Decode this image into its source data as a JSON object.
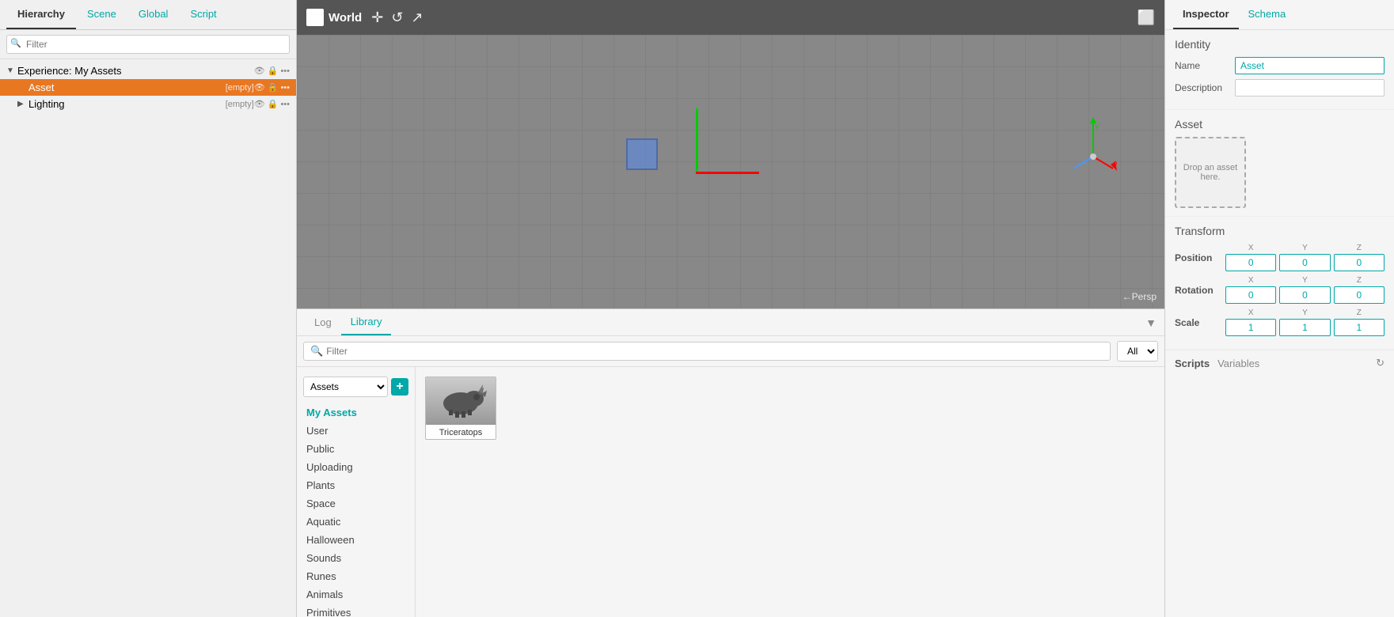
{
  "left_panel": {
    "tabs": [
      {
        "id": "hierarchy",
        "label": "Hierarchy",
        "active": true
      },
      {
        "id": "scene",
        "label": "Scene",
        "active": false
      },
      {
        "id": "global",
        "label": "Global",
        "active": false
      },
      {
        "id": "script",
        "label": "Script",
        "active": false
      }
    ],
    "filter_placeholder": "Filter",
    "tree": {
      "experience_label": "Experience: My Assets",
      "experience_badge": "",
      "asset_label": "Asset",
      "asset_badge": "[empty]",
      "lighting_label": "Lighting",
      "lighting_badge": "[empty]"
    }
  },
  "viewport": {
    "world_title": "World",
    "persp_label": "←Persp"
  },
  "bottom_panel": {
    "tabs": [
      {
        "id": "log",
        "label": "Log",
        "active": false
      },
      {
        "id": "library",
        "label": "Library",
        "active": true
      }
    ],
    "search_placeholder": "Filter",
    "filter_options": [
      "All"
    ],
    "assets_dropdown_value": "Assets",
    "categories": [
      {
        "id": "my-assets",
        "label": "My Assets",
        "active": true
      },
      {
        "id": "user",
        "label": "User",
        "active": false
      },
      {
        "id": "public",
        "label": "Public",
        "active": false
      },
      {
        "id": "uploading",
        "label": "Uploading",
        "active": false
      },
      {
        "id": "plants",
        "label": "Plants",
        "active": false
      },
      {
        "id": "space",
        "label": "Space",
        "active": false
      },
      {
        "id": "aquatic",
        "label": "Aquatic",
        "active": false
      },
      {
        "id": "halloween",
        "label": "Halloween",
        "active": false
      },
      {
        "id": "sounds",
        "label": "Sounds",
        "active": false
      },
      {
        "id": "runes",
        "label": "Runes",
        "active": false
      },
      {
        "id": "animals",
        "label": "Animals",
        "active": false
      },
      {
        "id": "primitives",
        "label": "Primitives",
        "active": false
      }
    ],
    "assets": [
      {
        "id": "triceratops",
        "label": "Triceratops"
      }
    ],
    "add_button_label": "+"
  },
  "right_panel": {
    "tabs": [
      {
        "id": "inspector",
        "label": "Inspector",
        "active": true
      },
      {
        "id": "schema",
        "label": "Schema",
        "active": false
      }
    ],
    "identity_title": "Identity",
    "name_label": "Name",
    "name_value": "Asset",
    "description_label": "Description",
    "description_value": "",
    "asset_title": "Asset",
    "drop_text": "Drop an asset here.",
    "transform_title": "Transform",
    "position_label": "Position",
    "position_x": "0",
    "position_y": "0",
    "position_z": "0",
    "rotation_label": "Rotation",
    "rotation_x": "0",
    "rotation_y": "0",
    "rotation_z": "0",
    "scale_label": "Scale",
    "scale_x": "1",
    "scale_y": "1",
    "scale_z": "1",
    "scripts_label": "Scripts",
    "variables_label": "Variables",
    "axis_x": "X",
    "axis_y": "Y",
    "axis_z": "Z"
  }
}
